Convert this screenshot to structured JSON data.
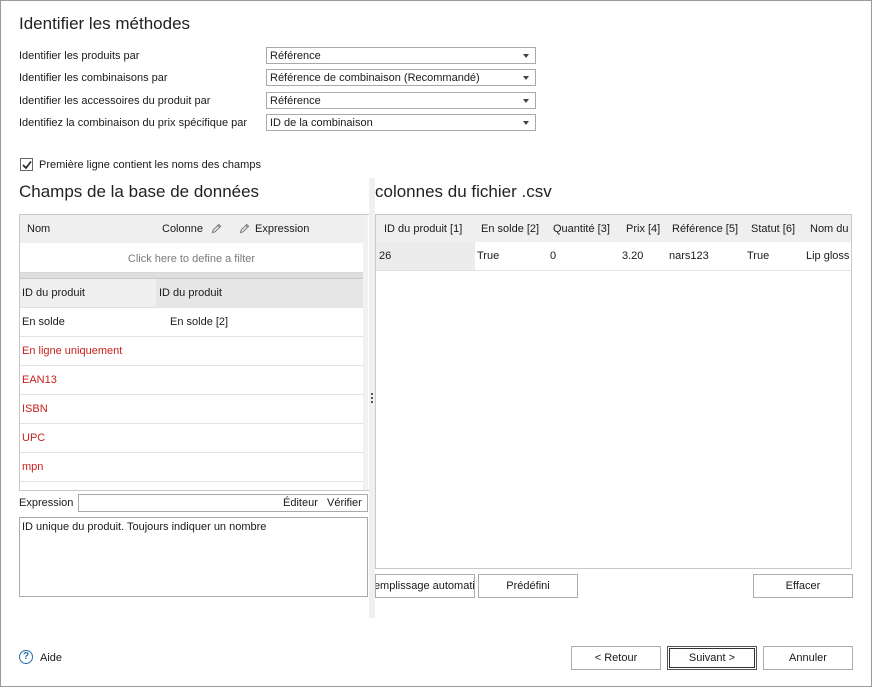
{
  "methods": {
    "title": "Identifier les méthodes",
    "rows": [
      {
        "label": "Identifier les produits par",
        "value": "Référence"
      },
      {
        "label": "Identifier les combinaisons par",
        "value": "Référence de combinaison (Recommandé)"
      },
      {
        "label": "Identifier les accessoires du produit par",
        "value": "Référence"
      },
      {
        "label": "Identifiez la combinaison du prix spécifique par",
        "value": "ID de la combinaison"
      }
    ]
  },
  "header_checkbox": {
    "label": "Première ligne contient les noms des champs",
    "checked": true
  },
  "db_fields": {
    "title": "Champs de la base de données",
    "columns": {
      "name": "Nom",
      "column": "Colonne",
      "expression": "Expression"
    },
    "filter_placeholder": "Click here to define a filter",
    "rows": [
      {
        "name": "ID du produit",
        "column": "ID du produit",
        "required": false
      },
      {
        "name": "En solde",
        "column": "En solde [2]",
        "required": false
      },
      {
        "name": "En ligne uniquement",
        "column": "",
        "required": true
      },
      {
        "name": "EAN13",
        "column": "",
        "required": true
      },
      {
        "name": "ISBN",
        "column": "",
        "required": true
      },
      {
        "name": "UPC",
        "column": "",
        "required": true
      },
      {
        "name": "mpn",
        "column": "",
        "required": true
      }
    ]
  },
  "expression": {
    "label": "Expression",
    "value": "",
    "editor_label": "Éditeur",
    "verify_label": "Vérifier",
    "description": "ID unique du produit. Toujours indiquer un nombre"
  },
  "csv": {
    "title": "colonnes du fichier .csv",
    "headers": [
      "ID du produit [1]",
      "En solde [2]",
      "Quantité [3]",
      "Prix [4]",
      "Référence [5]",
      "Statut [6]",
      "Nom du"
    ],
    "row": [
      "26",
      "True",
      "0",
      "3.20",
      "nars123",
      "True",
      "Lip gloss"
    ],
    "autofill_label": "Remplissage automatique",
    "preset_label": "Prédéfini",
    "clear_label": "Effacer"
  },
  "footer": {
    "help_label": "Aide",
    "back_label": "< Retour",
    "next_label": "Suivant >",
    "cancel_label": "Annuler"
  },
  "colors": {
    "required_field": "#c8211d",
    "accent": "#2b6cb0"
  },
  "icons": {
    "pencil": "pencil-icon",
    "help": "help-icon",
    "check": "checkmark-icon"
  }
}
